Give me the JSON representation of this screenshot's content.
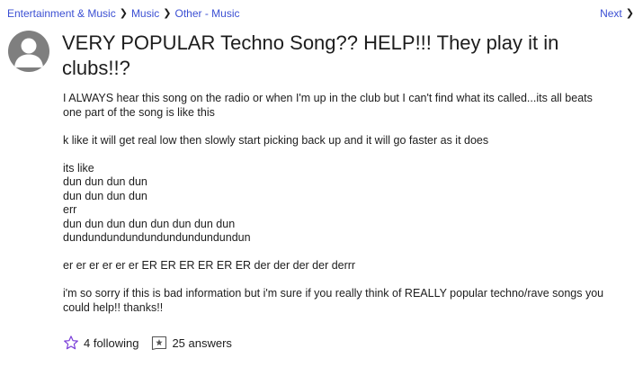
{
  "breadcrumb": {
    "items": [
      "Entertainment & Music",
      "Music",
      "Other - Music"
    ],
    "next_label": "Next"
  },
  "question": {
    "title": "VERY POPULAR Techno Song?? HELP!!! They play it in clubs!!?",
    "paragraphs": [
      "I ALWAYS hear this song on the radio or when I'm up in the club but I can't find what its called...its all beats\none part of the song is like this",
      "k like it will get real low then slowly start picking back up and it will go faster as it does",
      "its like\ndun dun dun dun\ndun dun dun dun\nerr\ndun dun dun dun dun dun dun dun\ndundundundundundundundundundun",
      "er er er er er er ER ER ER ER ER ER der der der der derrr",
      "i'm so sorry if this is bad information but i'm sure if you really think of REALLY popular techno/rave songs you\ncould help!! thanks!!"
    ]
  },
  "actions": {
    "following_label": "4 following",
    "answers_label": "25 answers"
  },
  "colors": {
    "link": "#3b4fd3",
    "star": "#7b3fd9",
    "avatar": "#7f7f7f"
  }
}
